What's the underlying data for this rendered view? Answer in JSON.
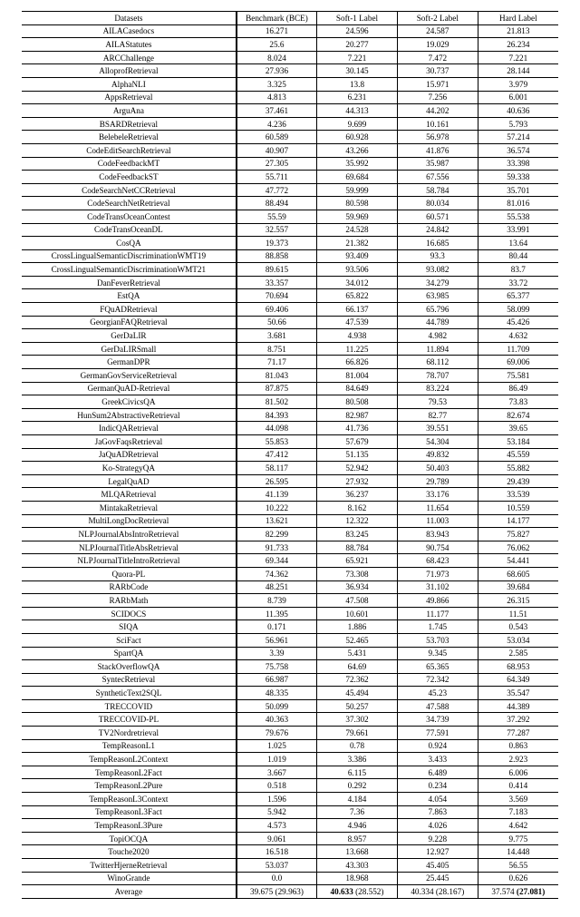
{
  "chart_data": {
    "type": "table",
    "columns": [
      "Datasets",
      "Benchmark (BCE)",
      "Soft-1 Label",
      "Soft-2 Label",
      "Hard Label"
    ],
    "rows": [
      [
        "AILACasedocs",
        "16.271",
        "24.596",
        "24.587",
        "21.813"
      ],
      [
        "AILAStatutes",
        "25.6",
        "20.277",
        "19.029",
        "26.234"
      ],
      [
        "ARCChallenge",
        "8.024",
        "7.221",
        "7.472",
        "7.221"
      ],
      [
        "AlloprofRetrieval",
        "27.936",
        "30.145",
        "30.737",
        "28.144"
      ],
      [
        "AlphaNLI",
        "3.325",
        "13.8",
        "15.971",
        "3.979"
      ],
      [
        "AppsRetrieval",
        "4.813",
        "6.231",
        "7.256",
        "6.001"
      ],
      [
        "ArguAna",
        "37.461",
        "44.313",
        "44.202",
        "40.636"
      ],
      [
        "BSARDRetrieval",
        "4.236",
        "9.699",
        "10.161",
        "5.793"
      ],
      [
        "BelebeleRetrieval",
        "60.589",
        "60.928",
        "56.978",
        "57.214"
      ],
      [
        "CodeEditSearchRetrieval",
        "40.907",
        "43.266",
        "41.876",
        "36.574"
      ],
      [
        "CodeFeedbackMT",
        "27.305",
        "35.992",
        "35.987",
        "33.398"
      ],
      [
        "CodeFeedbackST",
        "55.711",
        "69.684",
        "67.556",
        "59.338"
      ],
      [
        "CodeSearchNetCCRetrieval",
        "47.772",
        "59.999",
        "58.784",
        "35.701"
      ],
      [
        "CodeSearchNetRetrieval",
        "88.494",
        "80.598",
        "80.034",
        "81.016"
      ],
      [
        "CodeTransOceanContest",
        "55.59",
        "59.969",
        "60.571",
        "55.538"
      ],
      [
        "CodeTransOceanDL",
        "32.557",
        "24.528",
        "24.842",
        "33.991"
      ],
      [
        "CosQA",
        "19.373",
        "21.382",
        "16.685",
        "13.64"
      ],
      [
        "CrossLingualSemanticDiscriminationWMT19",
        "88.858",
        "93.409",
        "93.3",
        "80.44"
      ],
      [
        "CrossLingualSemanticDiscriminationWMT21",
        "89.615",
        "93.506",
        "93.082",
        "83.7"
      ],
      [
        "DanFeverRetrieval",
        "33.357",
        "34.012",
        "34.279",
        "33.72"
      ],
      [
        "EstQA",
        "70.694",
        "65.822",
        "63.985",
        "65.377"
      ],
      [
        "FQuADRetrieval",
        "69.406",
        "66.137",
        "65.796",
        "58.099"
      ],
      [
        "GeorgianFAQRetrieval",
        "50.66",
        "47.539",
        "44.789",
        "45.426"
      ],
      [
        "GerDaLIR",
        "3.681",
        "4.938",
        "4.982",
        "4.632"
      ],
      [
        "GerDaLIRSmall",
        "8.751",
        "11.225",
        "11.894",
        "11.709"
      ],
      [
        "GermanDPR",
        "71.17",
        "66.826",
        "68.112",
        "69.006"
      ],
      [
        "GermanGovServiceRetrieval",
        "81.043",
        "81.004",
        "78.707",
        "75.581"
      ],
      [
        "GermanQuAD-Retrieval",
        "87.875",
        "84.649",
        "83.224",
        "86.49"
      ],
      [
        "GreekCivicsQA",
        "81.502",
        "80.508",
        "79.53",
        "73.83"
      ],
      [
        "HunSum2AbstractiveRetrieval",
        "84.393",
        "82.987",
        "82.77",
        "82.674"
      ],
      [
        "IndicQARetrieval",
        "44.098",
        "41.736",
        "39.551",
        "39.65"
      ],
      [
        "JaGovFaqsRetrieval",
        "55.853",
        "57.679",
        "54.304",
        "53.184"
      ],
      [
        "JaQuADRetrieval",
        "47.412",
        "51.135",
        "49.832",
        "45.559"
      ],
      [
        "Ko-StrategyQA",
        "58.117",
        "52.942",
        "50.403",
        "55.882"
      ],
      [
        "LegalQuAD",
        "26.595",
        "27.932",
        "29.789",
        "29.439"
      ],
      [
        "MLQARetrieval",
        "41.139",
        "36.237",
        "33.176",
        "33.539"
      ],
      [
        "MintakaRetrieval",
        "10.222",
        "8.162",
        "11.654",
        "10.559"
      ],
      [
        "MultiLongDocRetrieval",
        "13.621",
        "12.322",
        "11.003",
        "14.177"
      ],
      [
        "NLPJournalAbsIntroRetrieval",
        "82.299",
        "83.245",
        "83.943",
        "75.827"
      ],
      [
        "NLPJournalTitleAbsRetrieval",
        "91.733",
        "88.784",
        "90.754",
        "76.062"
      ],
      [
        "NLPJournalTitleIntroRetrieval",
        "69.344",
        "65.921",
        "68.423",
        "54.441"
      ],
      [
        "Quora-PL",
        "74.362",
        "73.308",
        "71.973",
        "68.605"
      ],
      [
        "RARbCode",
        "48.251",
        "36.934",
        "31.102",
        "39.684"
      ],
      [
        "RARbMath",
        "8.739",
        "47.508",
        "49.866",
        "26.315"
      ],
      [
        "SCIDOCS",
        "11.395",
        "10.601",
        "11.177",
        "11.51"
      ],
      [
        "SIQA",
        "0.171",
        "1.886",
        "1.745",
        "0.543"
      ],
      [
        "SciFact",
        "56.961",
        "52.465",
        "53.703",
        "53.034"
      ],
      [
        "SpartQA",
        "3.39",
        "5.431",
        "9.345",
        "2.585"
      ],
      [
        "StackOverflowQA",
        "75.758",
        "64.69",
        "65.365",
        "68.953"
      ],
      [
        "SyntecRetrieval",
        "66.987",
        "72.362",
        "72.342",
        "64.349"
      ],
      [
        "SyntheticText2SQL",
        "48.335",
        "45.494",
        "45.23",
        "35.547"
      ],
      [
        "TRECCOVID",
        "50.099",
        "50.257",
        "47.588",
        "44.389"
      ],
      [
        "TRECCOVID-PL",
        "40.363",
        "37.302",
        "34.739",
        "37.292"
      ],
      [
        "TV2Nordretrieval",
        "79.676",
        "79.661",
        "77.591",
        "77.287"
      ],
      [
        "TempReasonL1",
        "1.025",
        "0.78",
        "0.924",
        "0.863"
      ],
      [
        "TempReasonL2Context",
        "1.019",
        "3.386",
        "3.433",
        "2.923"
      ],
      [
        "TempReasonL2Fact",
        "3.667",
        "6.115",
        "6.489",
        "6.006"
      ],
      [
        "TempReasonL2Pure",
        "0.518",
        "0.292",
        "0.234",
        "0.414"
      ],
      [
        "TempReasonL3Context",
        "1.596",
        "4.184",
        "4.054",
        "3.569"
      ],
      [
        "TempReasonL3Fact",
        "5.942",
        "7.36",
        "7.863",
        "7.183"
      ],
      [
        "TempReasonL3Pure",
        "4.573",
        "4.946",
        "4.026",
        "4.642"
      ],
      [
        "TopiOCQA",
        "9.061",
        "8.957",
        "9.228",
        "9.775"
      ],
      [
        "Touche2020",
        "16.518",
        "13.668",
        "12.927",
        "14.448"
      ],
      [
        "TwitterHjerneRetrieval",
        "53.037",
        "43.303",
        "45.405",
        "56.55"
      ],
      [
        "WinoGrande",
        "0.0",
        "18.968",
        "25.445",
        "0.626"
      ]
    ],
    "average_row": {
      "label": "Average",
      "cells": [
        {
          "a": "39.675",
          "b": "(29.963)",
          "bold_a": false,
          "bold_b": false
        },
        {
          "a": "40.633",
          "b": "(28.552)",
          "bold_a": true,
          "bold_b": false
        },
        {
          "a": "40.334",
          "b": "(28.167)",
          "bold_a": false,
          "bold_b": false
        },
        {
          "a": "37.574",
          "b": "(27.081)",
          "bold_a": false,
          "bold_b": true
        }
      ]
    }
  }
}
